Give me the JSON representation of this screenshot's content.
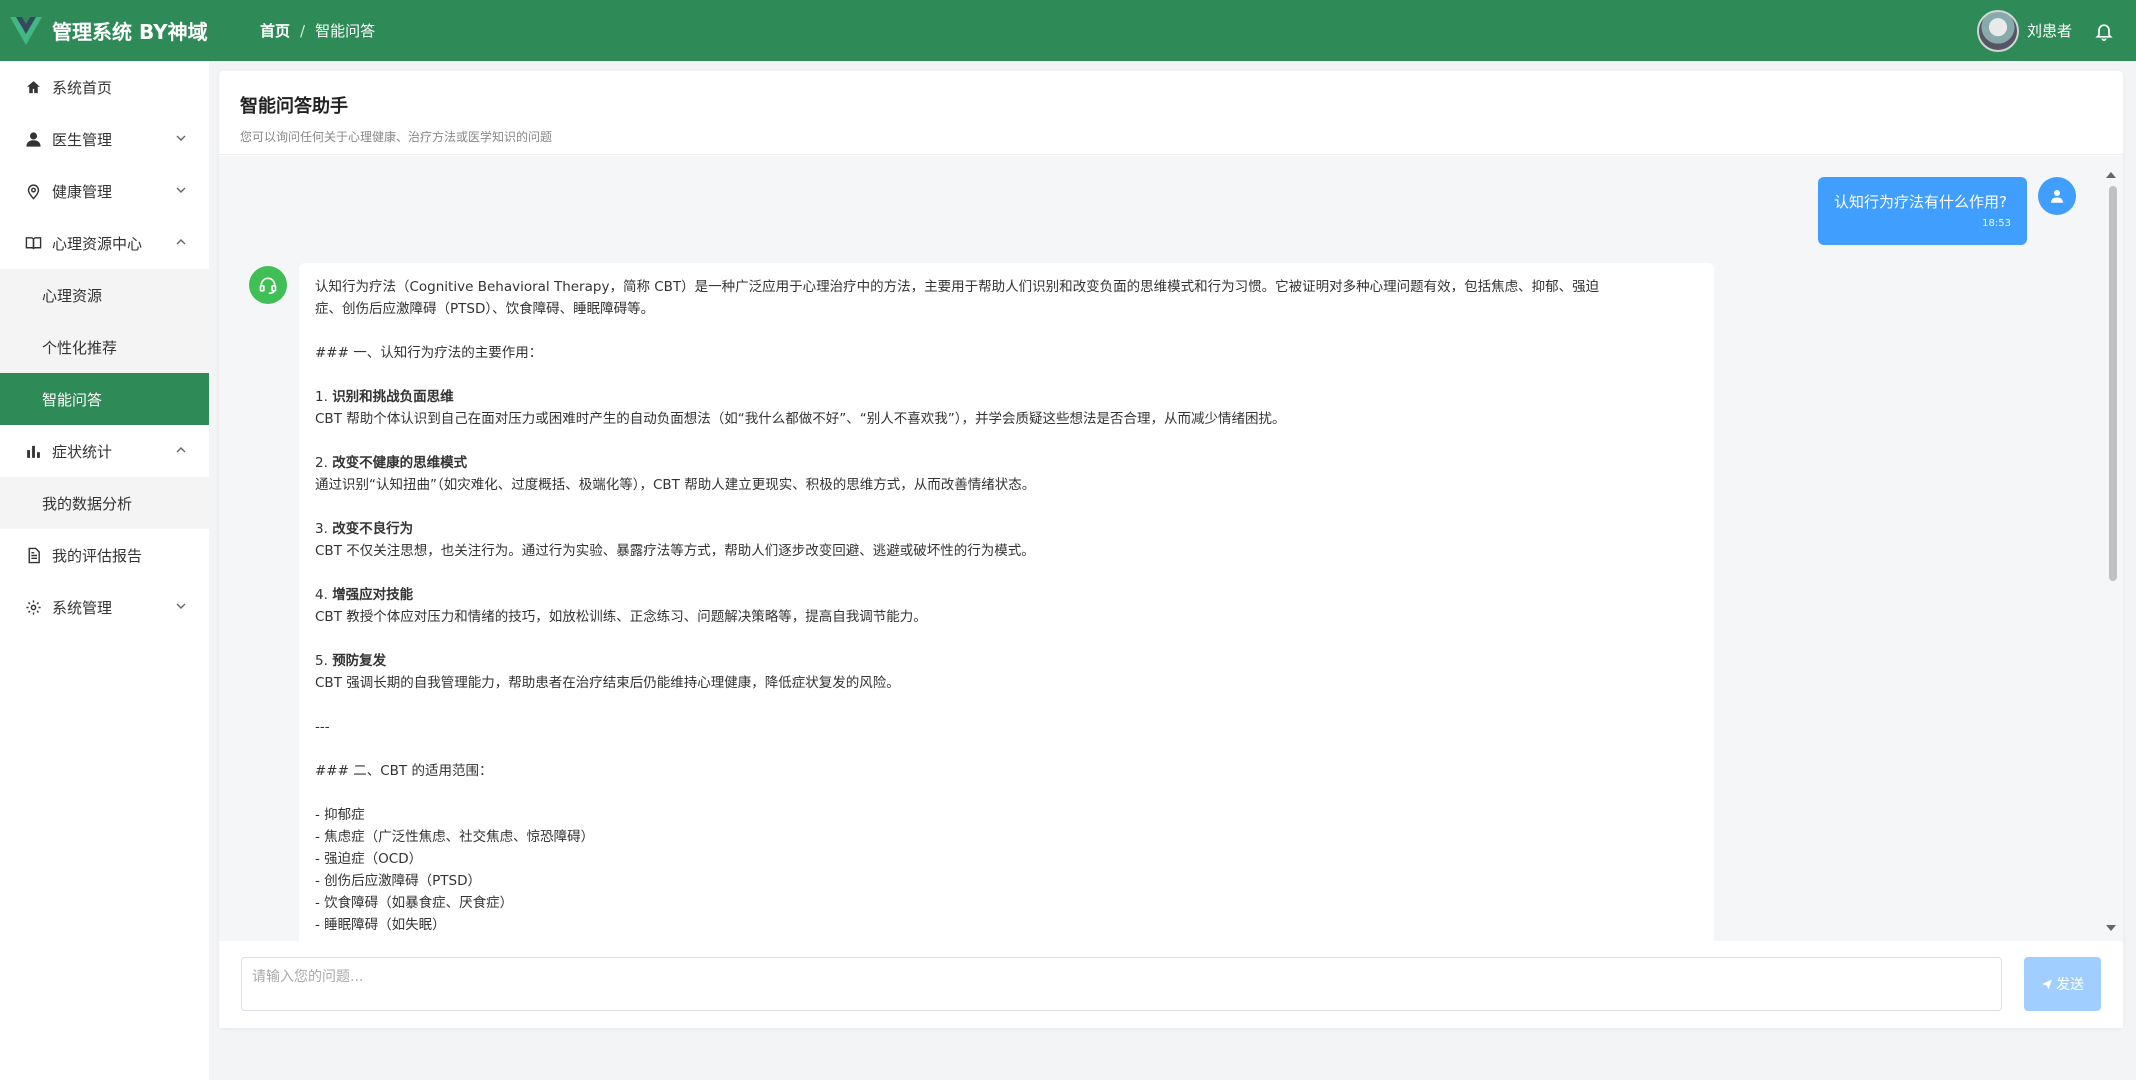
{
  "header": {
    "app_title": "管理系统 BY神域",
    "breadcrumb_home": "首页",
    "breadcrumb_sep": "/",
    "breadcrumb_current": "智能问答",
    "username": "刘患者",
    "bg_color": "#2e8b57"
  },
  "sidebar": {
    "items": [
      {
        "label": "系统首页",
        "icon": "home-icon"
      },
      {
        "label": "医生管理",
        "icon": "user-icon",
        "chevron": "down"
      },
      {
        "label": "健康管理",
        "icon": "location-icon",
        "chevron": "down"
      },
      {
        "label": "心理资源中心",
        "icon": "book-icon",
        "chevron": "up"
      },
      {
        "label": "症状统计",
        "icon": "bar-chart-icon",
        "chevron": "up"
      },
      {
        "label": "我的评估报告",
        "icon": "document-icon"
      },
      {
        "label": "系统管理",
        "icon": "gear-icon",
        "chevron": "down"
      }
    ],
    "resource_sub": [
      "心理资源",
      "个性化推荐",
      "智能问答"
    ],
    "stats_sub": [
      "我的数据分析"
    ],
    "active_color": "#2e8b57"
  },
  "main": {
    "title": "智能问答助手",
    "subtitle": "您可以询问任何关于心理健康、治疗方法或医学知识的问题"
  },
  "chat": {
    "user_message": "认知行为疗法有什么作用?",
    "user_time": "18:53",
    "bot_lines": [
      "认知行为疗法（Cognitive Behavioral Therapy，简称 CBT）是一种广泛应用于心理治疗中的方法，主要用于帮助人们识别和改变负面的思维模式和行为习惯。它被证明对多种心理问题有效，包括焦虑、抑郁、强迫",
      "症、创伤后应激障碍（PTSD）、饮食障碍、睡眠障碍等。",
      "",
      "### 一、认知行为疗法的主要作用：",
      "",
      "1. 识别和挑战负面思维",
      "CBT 帮助个体认识到自己在面对压力或困难时产生的自动负面想法（如“我什么都做不好”、“别人不喜欢我”），并学会质疑这些想法是否合理，从而减少情绪困扰。",
      "",
      "2. 改变不健康的思维模式",
      "通过识别“认知扭曲”（如灾难化、过度概括、极端化等），CBT 帮助人建立更现实、积极的思维方式，从而改善情绪状态。",
      "",
      "3. 改变不良行为",
      "CBT 不仅关注思想，也关注行为。通过行为实验、暴露疗法等方式，帮助人们逐步改变回避、逃避或破坏性的行为模式。",
      "",
      "4. 增强应对技能",
      "CBT 教授个体应对压力和情绪的技巧，如放松训练、正念练习、问题解决策略等，提高自我调节能力。",
      "",
      "5. 预防复发",
      "CBT 强调长期的自我管理能力，帮助患者在治疗结束后仍能维持心理健康，降低症状复发的风险。",
      "",
      "---",
      "",
      "### 二、CBT 的适用范围：",
      "",
      "- 抑郁症",
      "- 焦虑症（广泛性焦虑、社交焦虑、惊恐障碍）",
      "- 强迫症（OCD）",
      "- 创伤后应激障碍（PTSD）",
      "- 饮食障碍（如暴食症、厌食症）",
      "- 睡眠障碍（如失眠）"
    ],
    "bold_numbers": [
      "1.",
      "2.",
      "3.",
      "4.",
      "5."
    ],
    "bold_headings": [
      "识别和挑战负面思维",
      "改变不健康的思维模式",
      "改变不良行为",
      "增强应对技能",
      "预防复发"
    ]
  },
  "input": {
    "placeholder": "请输入您的问题...",
    "send_label": "发送"
  }
}
